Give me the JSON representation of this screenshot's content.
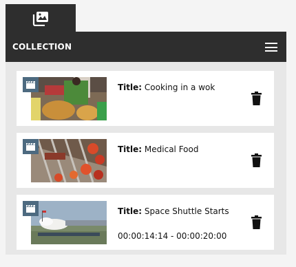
{
  "tab": {
    "icon": "photo-library-icon"
  },
  "header": {
    "title": "COLLECTION",
    "menu_icon": "hamburger-menu-icon"
  },
  "items": [
    {
      "title_label": "Title:",
      "title": "Cooking in a wok",
      "badge_icon": "clapperboard-icon",
      "delete_icon": "trash-icon",
      "time_range": ""
    },
    {
      "title_label": "Title:",
      "title": "Medical Food",
      "badge_icon": "clapperboard-icon",
      "delete_icon": "trash-icon",
      "time_range": ""
    },
    {
      "title_label": "Title:",
      "title": "Space Shuttle Starts",
      "badge_icon": "clapperboard-icon",
      "delete_icon": "trash-icon",
      "time_range": "00:00:14:14 - 00:00:20:00"
    }
  ],
  "colors": {
    "header_bg": "#2e2e2e",
    "badge_bg": "#4d6a80",
    "panel_bg": "#e7e7e7"
  }
}
